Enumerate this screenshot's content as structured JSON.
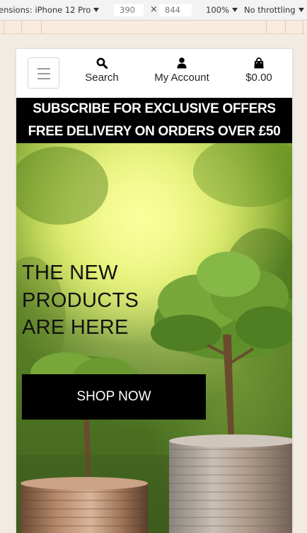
{
  "devtools": {
    "dimensions_label": "ensions: iPhone 12 Pro",
    "width_value": "390",
    "times_glyph": "×",
    "height_value": "844",
    "zoom": "100%",
    "throttling": "No throttling"
  },
  "navbar": {
    "toggler_icon": "hamburger-icon",
    "search_label": "Search",
    "account_label": "My Account",
    "cart_total": "$0.00",
    "icons": [
      "search-icon",
      "user-icon",
      "shopping-bag-icon"
    ]
  },
  "banner": {
    "line1": "SUBSCRIBE FOR EXCLUSIVE OFFERS",
    "line2": "FREE DELIVERY ON ORDERS OVER £50"
  },
  "hero": {
    "title_line1": "THE NEW",
    "title_line2": "PRODUCTS",
    "title_line3": "ARE HERE",
    "cta_label": "SHOP NOW"
  },
  "colors": {
    "banner_bg": "#000000",
    "banner_text": "#ffffff",
    "cta_bg": "#000000",
    "cta_text": "#ffffff"
  }
}
